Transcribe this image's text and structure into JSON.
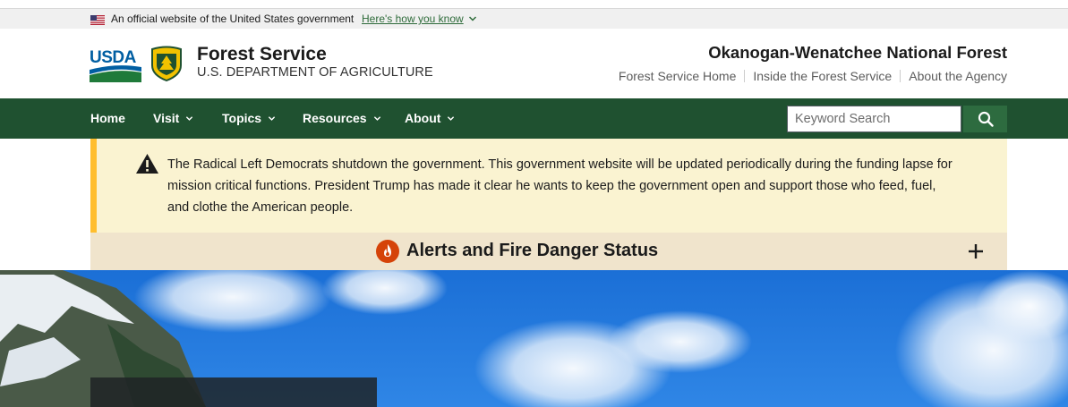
{
  "gov_banner": {
    "text": "An official website of the United States government",
    "link": "Here's how you know"
  },
  "header": {
    "usda_logo_text": "USDA",
    "agency_name": "Forest Service",
    "agency_dept": "U.S. DEPARTMENT OF AGRICULTURE",
    "forest_name": "Okanogan-Wenatchee National Forest",
    "util_links": [
      "Forest Service Home",
      "Inside the Forest Service",
      "About the Agency"
    ]
  },
  "nav": {
    "items": [
      {
        "label": "Home",
        "dropdown": false
      },
      {
        "label": "Visit",
        "dropdown": true
      },
      {
        "label": "Topics",
        "dropdown": true
      },
      {
        "label": "Resources",
        "dropdown": true
      },
      {
        "label": "About",
        "dropdown": true
      }
    ],
    "search_placeholder": "Keyword Search",
    "search_icon": "search-icon"
  },
  "notice": {
    "icon": "warning-icon",
    "text": "The Radical Left Democrats shutdown the government. This government website will be updated periodically during the funding lapse for mission critical functions. President Trump has made it clear he wants to keep the government open and support those who feed, fuel, and clothe the American people."
  },
  "alerts": {
    "icon": "fire-icon",
    "title": "Alerts and Fire Danger Status",
    "toggle_icon": "plus-icon"
  },
  "colors": {
    "nav_green": "#1f5130",
    "link_green": "#2e6b3a",
    "notice_bg": "#faf3d1",
    "notice_border": "#ffbe2e",
    "alerts_bg": "#f0e4cc",
    "fire_orange": "#d54309"
  }
}
